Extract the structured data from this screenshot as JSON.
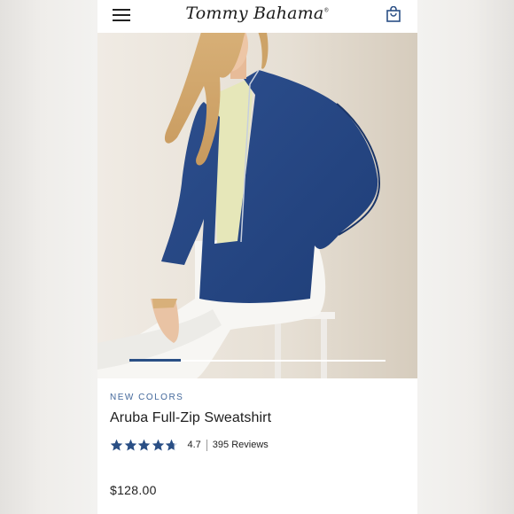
{
  "header": {
    "brand": "Tommy Bahama",
    "brand_mark": "®",
    "menu_icon": "hamburger-menu-icon",
    "bag_icon": "shopping-bag-icon"
  },
  "gallery": {
    "image_count_shown": 1,
    "progress_fraction": 0.2
  },
  "product": {
    "badge": "NEW COLORS",
    "name": "Aruba Full-Zip Sweatshirt",
    "rating_value": "4.7",
    "rating_stars": 4.7,
    "reviews_label": "395 Reviews",
    "price": "$128.00"
  },
  "colors": {
    "accent": "#2a4f85",
    "badge_text": "#43689b",
    "star": "#2a4f85"
  }
}
